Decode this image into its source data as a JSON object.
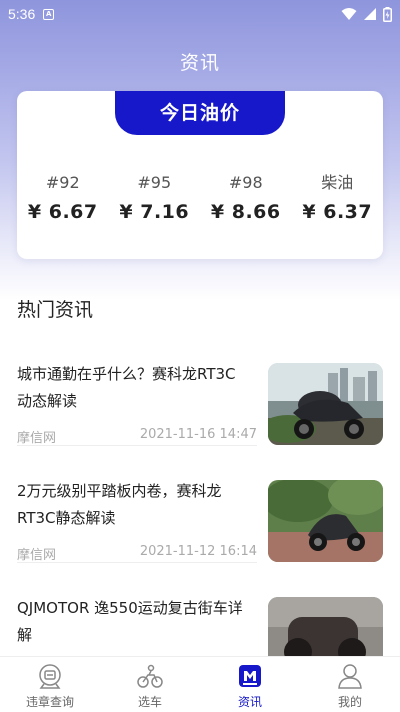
{
  "status_bar": {
    "time": "5:36"
  },
  "header": {
    "title": "资讯"
  },
  "oil_price": {
    "badge": "今日油价",
    "items": [
      {
        "grade": "#92",
        "price": "¥ 6.67"
      },
      {
        "grade": "#95",
        "price": "¥ 7.16"
      },
      {
        "grade": "#98",
        "price": "¥ 8.66"
      },
      {
        "grade": "柴油",
        "price": "¥ 6.37"
      }
    ]
  },
  "hot_news": {
    "title": "热门资讯",
    "items": [
      {
        "title": "城市通勤在乎什么？赛科龙RT3C动态解读",
        "source": "摩信网",
        "time": "2021-11-16 14:47"
      },
      {
        "title": "2万元级别平踏板内卷，赛科龙RT3C静态解读",
        "source": "摩信网",
        "time": "2021-11-12 16:14"
      },
      {
        "title": "QJMOTOR 逸550运动复古街车详解",
        "source": "",
        "time": ""
      }
    ]
  },
  "tab_bar": {
    "tabs": [
      {
        "label": "违章查询",
        "icon": "violation-query-icon"
      },
      {
        "label": "选车",
        "icon": "motorcycle-icon"
      },
      {
        "label": "资讯",
        "icon": "news-icon"
      },
      {
        "label": "我的",
        "icon": "profile-icon"
      }
    ],
    "active_color": "#1618c9"
  }
}
